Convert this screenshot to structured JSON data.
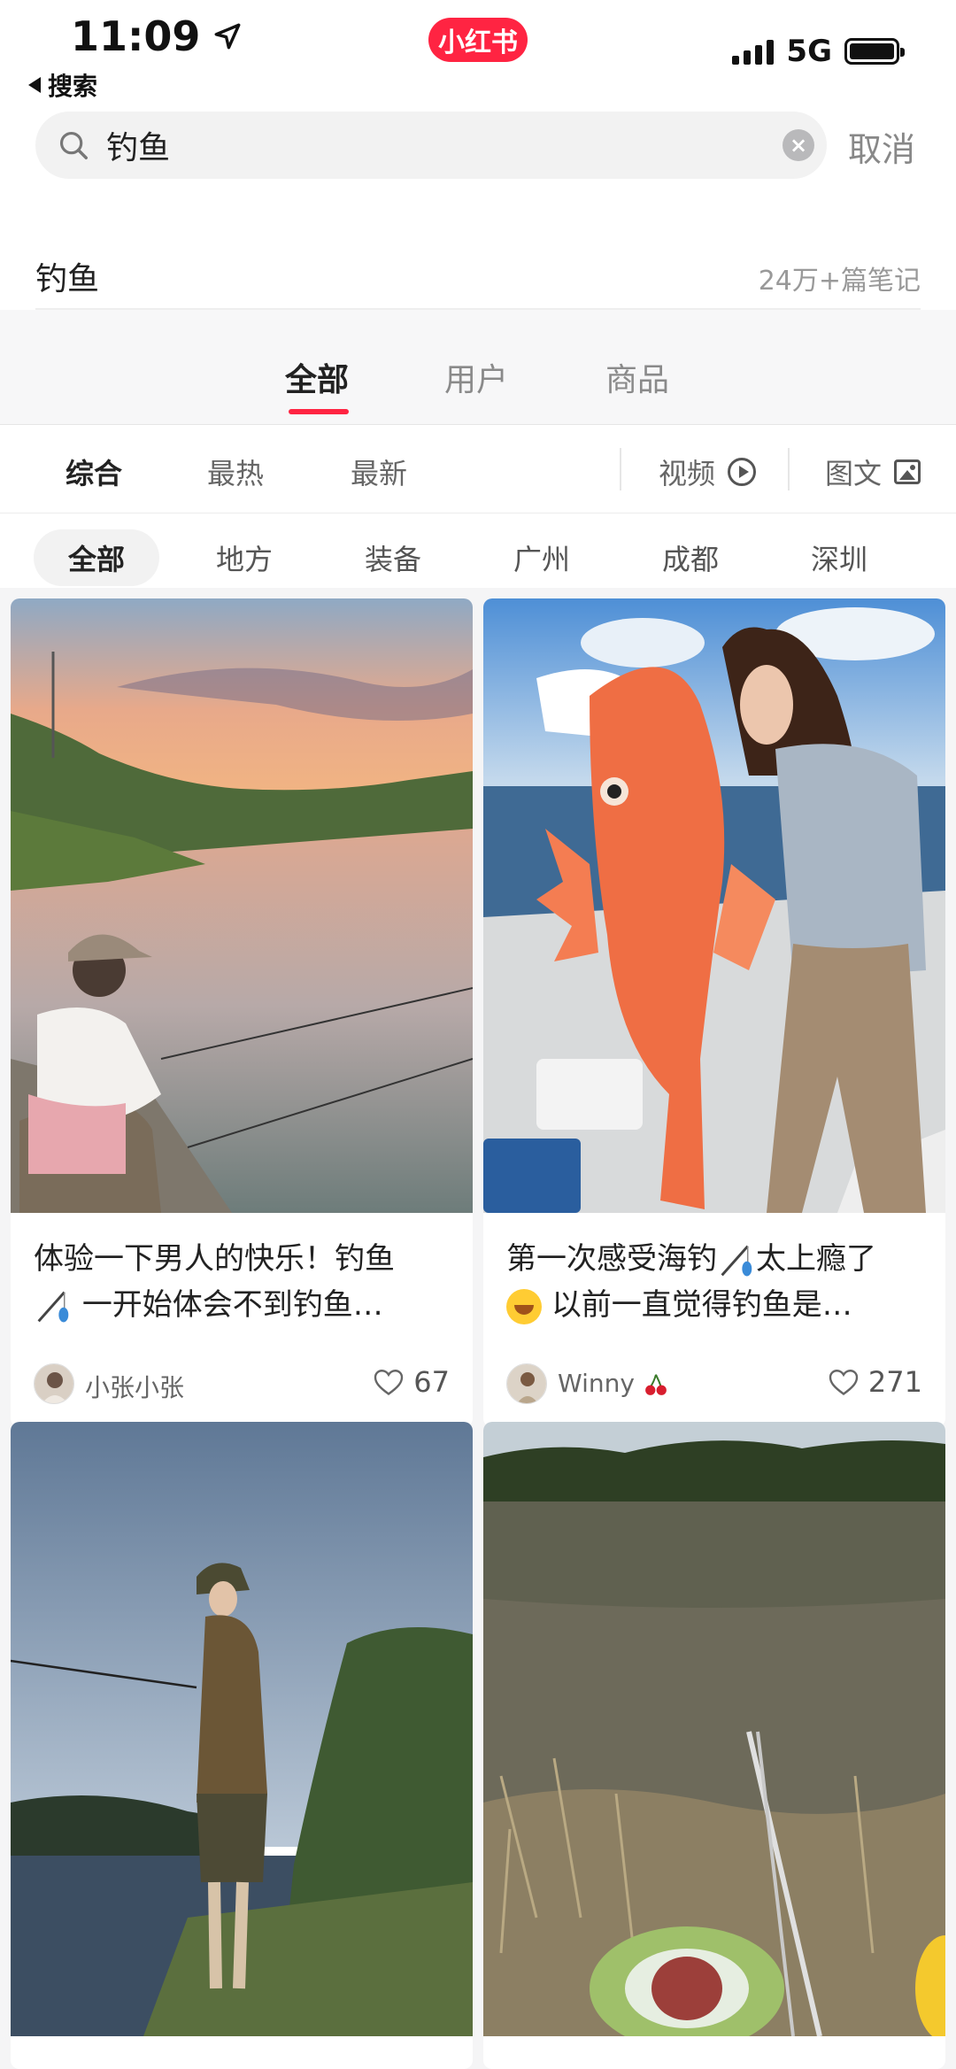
{
  "status_bar": {
    "time": "11:09",
    "network": "5G",
    "battery_level": 1.0
  },
  "brand": {
    "logo_text": "小红书",
    "color": "#ff2442"
  },
  "back": {
    "label": "搜索"
  },
  "search": {
    "value": "钓鱼",
    "placeholder": "",
    "cancel_label": "取消"
  },
  "result_header": {
    "keyword": "钓鱼",
    "count_label": "24万+篇笔记"
  },
  "tabs": [
    {
      "label": "全部",
      "active": true
    },
    {
      "label": "用户",
      "active": false
    },
    {
      "label": "商品",
      "active": false
    }
  ],
  "sort": {
    "items": [
      {
        "label": "综合",
        "active": true
      },
      {
        "label": "最热",
        "active": false
      },
      {
        "label": "最新",
        "active": false
      }
    ],
    "video_label": "视频",
    "image_text_label": "图文"
  },
  "chips": [
    {
      "label": "全部",
      "active": true
    },
    {
      "label": "地方",
      "active": false
    },
    {
      "label": "装备",
      "active": false
    },
    {
      "label": "广州",
      "active": false
    },
    {
      "label": "成都",
      "active": false
    },
    {
      "label": "深圳",
      "active": false
    }
  ],
  "cards": [
    {
      "title_line1": "体验一下男人的快乐！钓鱼",
      "title_line2": "一开始体会不到钓鱼…",
      "author": "小张小张",
      "likes": "67"
    },
    {
      "title_line1": "第一次感受海钓",
      "title_line1_b": "太上瘾了",
      "title_line2": "以前一直觉得钓鱼是…",
      "author": "Winny",
      "likes": "271"
    }
  ],
  "colors": {
    "accent": "#ff2442",
    "bg": "#f5f5f6"
  }
}
